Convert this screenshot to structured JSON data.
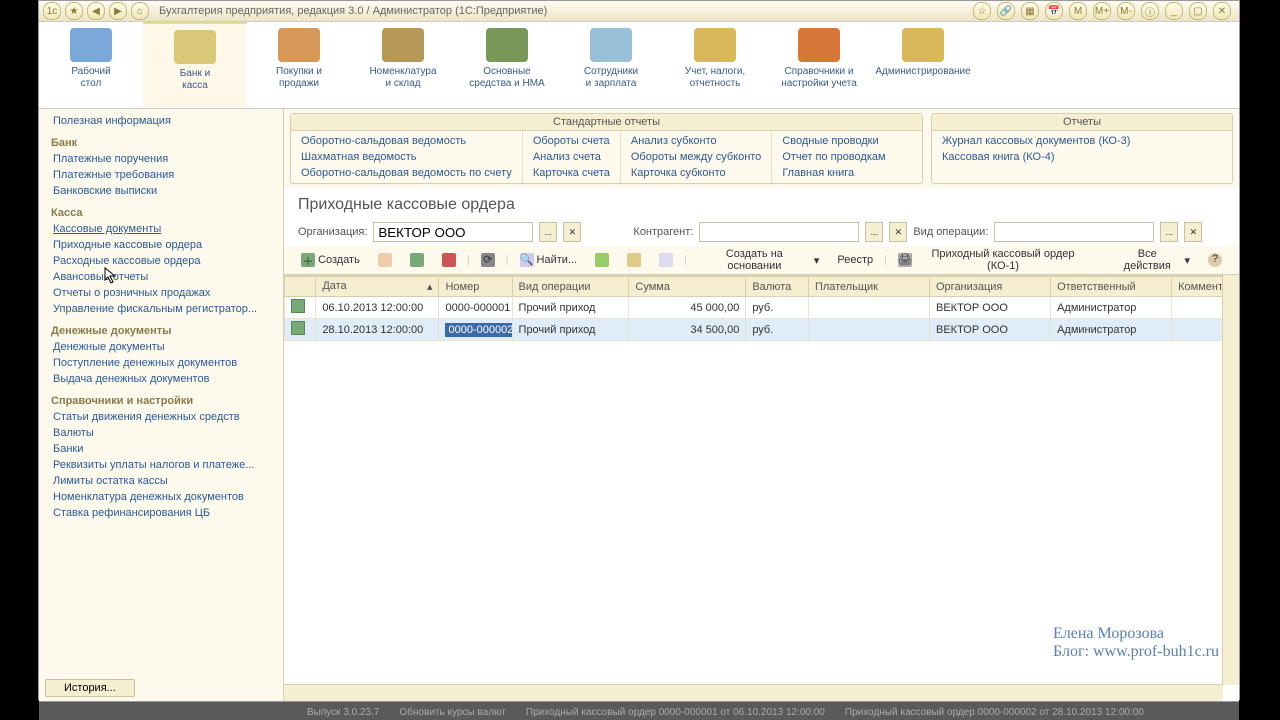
{
  "window": {
    "title": "Бухгалтерия предприятия, редакция 3.0 / Администратор   (1С:Предприятие)"
  },
  "nav": [
    {
      "label": "Рабочий\nстол"
    },
    {
      "label": "Банк и\nкасса"
    },
    {
      "label": "Покупки и\nпродажи"
    },
    {
      "label": "Номенклатура\nи склад"
    },
    {
      "label": "Основные\nсредства и НМА"
    },
    {
      "label": "Сотрудники\nи зарплата"
    },
    {
      "label": "Учет, налоги,\nотчетность"
    },
    {
      "label": "Справочники и\nнастройки учета"
    },
    {
      "label": "Администрирование"
    }
  ],
  "sidebar": {
    "top_link": "Полезная информация",
    "groups": [
      {
        "title": "Банк",
        "items": [
          "Платежные поручения",
          "Платежные требования",
          "Банковские выписки"
        ]
      },
      {
        "title": "Касса",
        "items": [
          "Кассовые документы",
          "Приходные кассовые ордера",
          "Расходные кассовые ордера",
          "Авансовые отчеты",
          "Отчеты о розничных продажах",
          "Управление фискальным регистратор..."
        ]
      },
      {
        "title": "Денежные документы",
        "items": [
          "Денежные документы",
          "Поступление денежных документов",
          "Выдача денежных документов"
        ]
      },
      {
        "title": "Справочники и настройки",
        "items": [
          "Статьи движения денежных средств",
          "Валюты",
          "Банки",
          "Реквизиты уплаты налогов и платеже...",
          "Лимиты остатка кассы",
          "Номенклатура денежных документов",
          "Ставка рефинансирования ЦБ"
        ]
      }
    ]
  },
  "std_reports": {
    "title": "Стандартные отчеты",
    "cols": [
      [
        "Оборотно-сальдовая ведомость",
        "Шахматная ведомость",
        "Оборотно-сальдовая ведомость по счету"
      ],
      [
        "Обороты счета",
        "Анализ счета",
        "Карточка счета"
      ],
      [
        "Анализ субконто",
        "Обороты между субконто",
        "Карточка субконто"
      ],
      [
        "Сводные проводки",
        "Отчет по проводкам",
        "Главная книга"
      ]
    ]
  },
  "reports": {
    "title": "Отчеты",
    "items": [
      "Журнал кассовых документов (КО-3)",
      "Кассовая книга (КО-4)"
    ]
  },
  "form": {
    "title": "Приходные кассовые ордера",
    "org_label": "Организация:",
    "org_value": "ВЕКТОР ООО",
    "contr_label": "Контрагент:",
    "oper_label": "Вид операции:"
  },
  "toolbar": {
    "create": "Создать",
    "find": "Найти...",
    "create_based": "Создать на основании",
    "registry": "Реестр",
    "print": "Приходный кассовый ордер (КО-1)",
    "all_actions": "Все действия"
  },
  "grid": {
    "cols": [
      "",
      "Дата",
      "Номер",
      "Вид операции",
      "Сумма",
      "Валюта",
      "Плательщик",
      "Организация",
      "Ответственный",
      "Коммент"
    ],
    "rows": [
      {
        "date": "06.10.2013 12:00:00",
        "num": "0000-000001",
        "oper": "Прочий приход",
        "sum": "45 000,00",
        "cur": "руб.",
        "payer": "",
        "org": "ВЕКТОР ООО",
        "resp": "Администратор"
      },
      {
        "date": "28.10.2013 12:00:00",
        "num": "0000-000002",
        "oper": "Прочий приход",
        "sum": "34 500,00",
        "cur": "руб.",
        "payer": "",
        "org": "ВЕКТОР ООО",
        "resp": "Администратор"
      }
    ]
  },
  "watermark": {
    "name": "Елена Морозова",
    "blog": "Блог: www.prof-buh1c.ru"
  },
  "history_btn": "История...",
  "status": {
    "s1": "Выпуск  3.0.23.7",
    "s2": "Обновить курсы валют",
    "s3": "Приходный кассовый ордер 0000-000001 от 06.10.2013 12:00:00",
    "s4": "Приходный кассовый ордер 0000-000002 от 28.10.2013 12:00:00"
  }
}
